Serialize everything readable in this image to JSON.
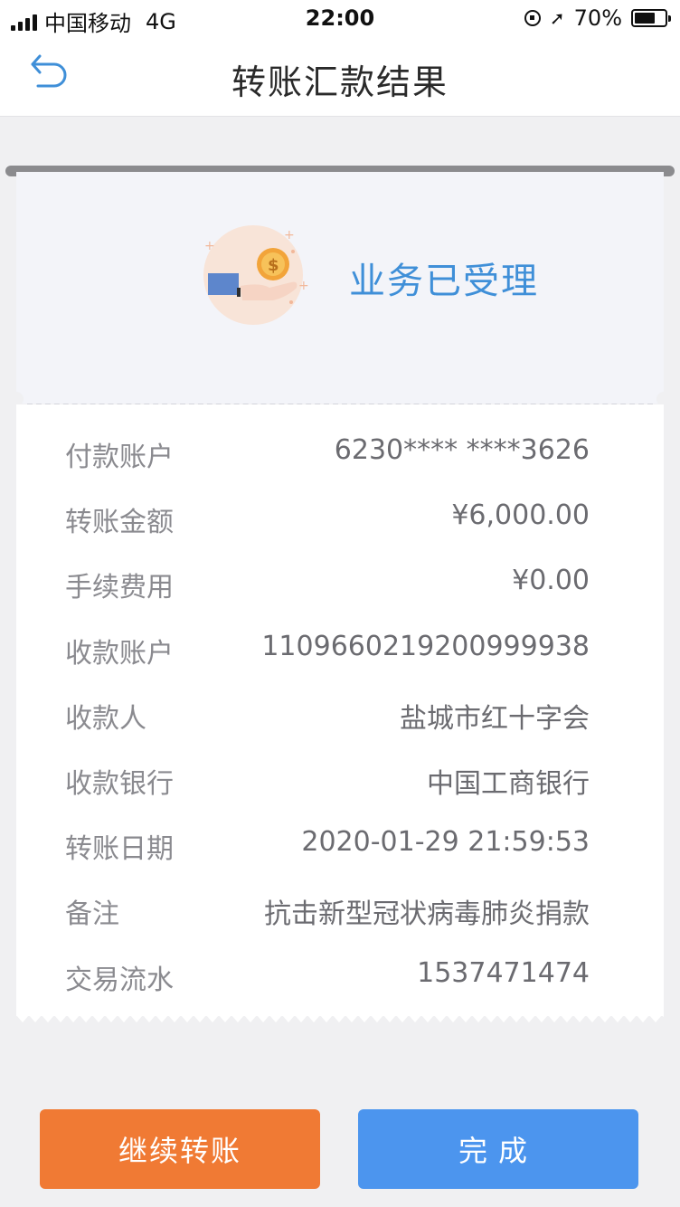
{
  "status_bar": {
    "carrier": "中国移动",
    "network": "4G",
    "time": "22:00",
    "battery": "70%",
    "battery_level": 0.7
  },
  "nav": {
    "title": "转账汇款结果",
    "back_icon": "back-arrow-icon"
  },
  "result": {
    "status_text": "业务已受理",
    "illustration_icon": "hand-coin-icon"
  },
  "details": [
    {
      "label": "付款账户",
      "value": "6230**** ****3626"
    },
    {
      "label": "转账金额",
      "value": "¥6,000.00"
    },
    {
      "label": "手续费用",
      "value": "¥0.00"
    },
    {
      "label": "收款账户",
      "value": "1109660219200999938"
    },
    {
      "label": "收款人",
      "value": "盐城市红十字会"
    },
    {
      "label": "收款银行",
      "value": "中国工商银行"
    },
    {
      "label": "转账日期",
      "value": "2020-01-29 21:59:53"
    },
    {
      "label": "备注",
      "value": "抗击新型冠状病毒肺炎捐款"
    },
    {
      "label": "交易流水",
      "value": "1537471474"
    }
  ],
  "buttons": {
    "continue_label": "继续转账",
    "done_label": "完成"
  },
  "colors": {
    "accent_blue": "#4c95ee",
    "accent_orange": "#f07a34",
    "status_blue": "#3f8fd8"
  }
}
